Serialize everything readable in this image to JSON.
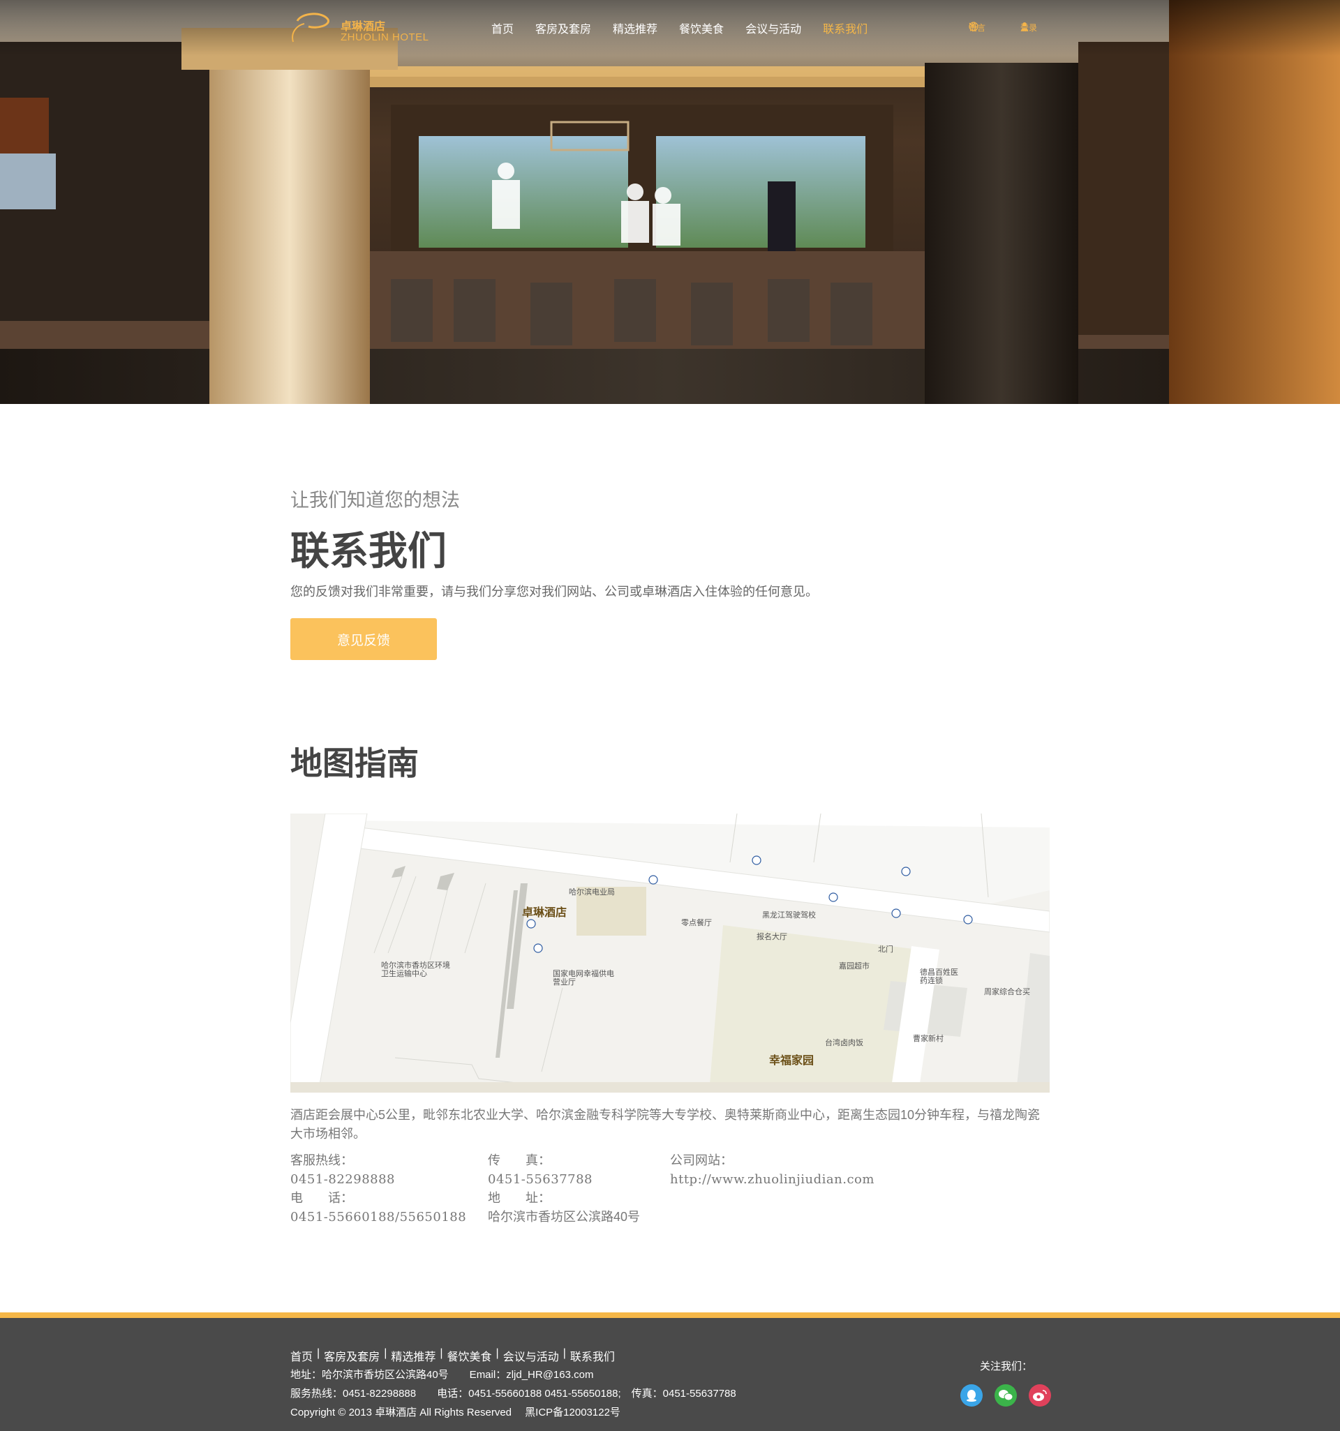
{
  "header": {
    "logo_cn": "卓琳酒店",
    "logo_en": "ZHUOLIN HOTEL",
    "nav": [
      "首页",
      "客房及套房",
      "精选推荐",
      "餐饮美食",
      "会议与活动",
      "联系我们"
    ],
    "active_index": 5,
    "language_label": "语言",
    "login_label": "登录"
  },
  "contact": {
    "subtitle": "让我们知道您的想法",
    "title": "联系我们",
    "description": "您的反馈对我们非常重要，请与我们分享您对我们网站、公司或卓琳酒店入住体验的任何意见。",
    "feedback_button": "意见反馈"
  },
  "map_section": {
    "title": "地图指南",
    "labels": {
      "hotel": "卓琳酒店",
      "power": "哈尔滨电业局",
      "snack": "零点餐厅",
      "driving": "黑龙江驾驶驾校",
      "signup": "报名大厅",
      "north_gate": "北门",
      "supermarket": "嘉园超市",
      "pharmacy": "德昌百姓医药连锁",
      "warehouse": "周家综合仓买",
      "grid": "国家电网幸福供电营业厅",
      "sanitation": "哈尔滨市香坊区环境卫生运输中心",
      "taiwan": "台湾卤肉饭",
      "caojia": "曹家新村",
      "community": "幸福家园"
    },
    "description": "酒店距会展中心5公里，毗邻东北农业大学、哈尔滨金融专科学院等大专学校、奥特莱斯商业中心，距离生态园10分钟车程，与禧龙陶瓷大市场相邻。",
    "hotline_label": "客服热线：",
    "hotline": "0451-82298888",
    "fax_label": "传　　真：",
    "fax": "0451-55637788",
    "website_label": "公司网站：",
    "website": "http://www.zhuolinjiudian.com",
    "phone_label": "电　　话：",
    "phone": "0451-55660188/55650188",
    "address_label": "地　　址：",
    "address": "哈尔滨市香坊区公滨路40号"
  },
  "footer": {
    "links": [
      "首页",
      "客房及套房",
      "精选推荐",
      "餐饮美食",
      "会议与活动",
      "联系我们"
    ],
    "address_line": "地址：哈尔滨市香坊区公滨路40号　　Email：zljd_HR@163.com",
    "hotline_line": "服务热线：0451-82298888　　电话：0451-55660188  0451-55650188;　传真：0451-55637788",
    "copyright_line": "Copyright © 2013 卓琳酒店 All Rights Reserved　 黑ICP备12003122号",
    "follow_label": "关注我们：",
    "social": [
      {
        "icon": "qq-icon",
        "color": "#3aa5e8"
      },
      {
        "icon": "wechat-icon",
        "color": "#3bb44a"
      },
      {
        "icon": "weibo-icon",
        "color": "#e0415b"
      }
    ]
  }
}
